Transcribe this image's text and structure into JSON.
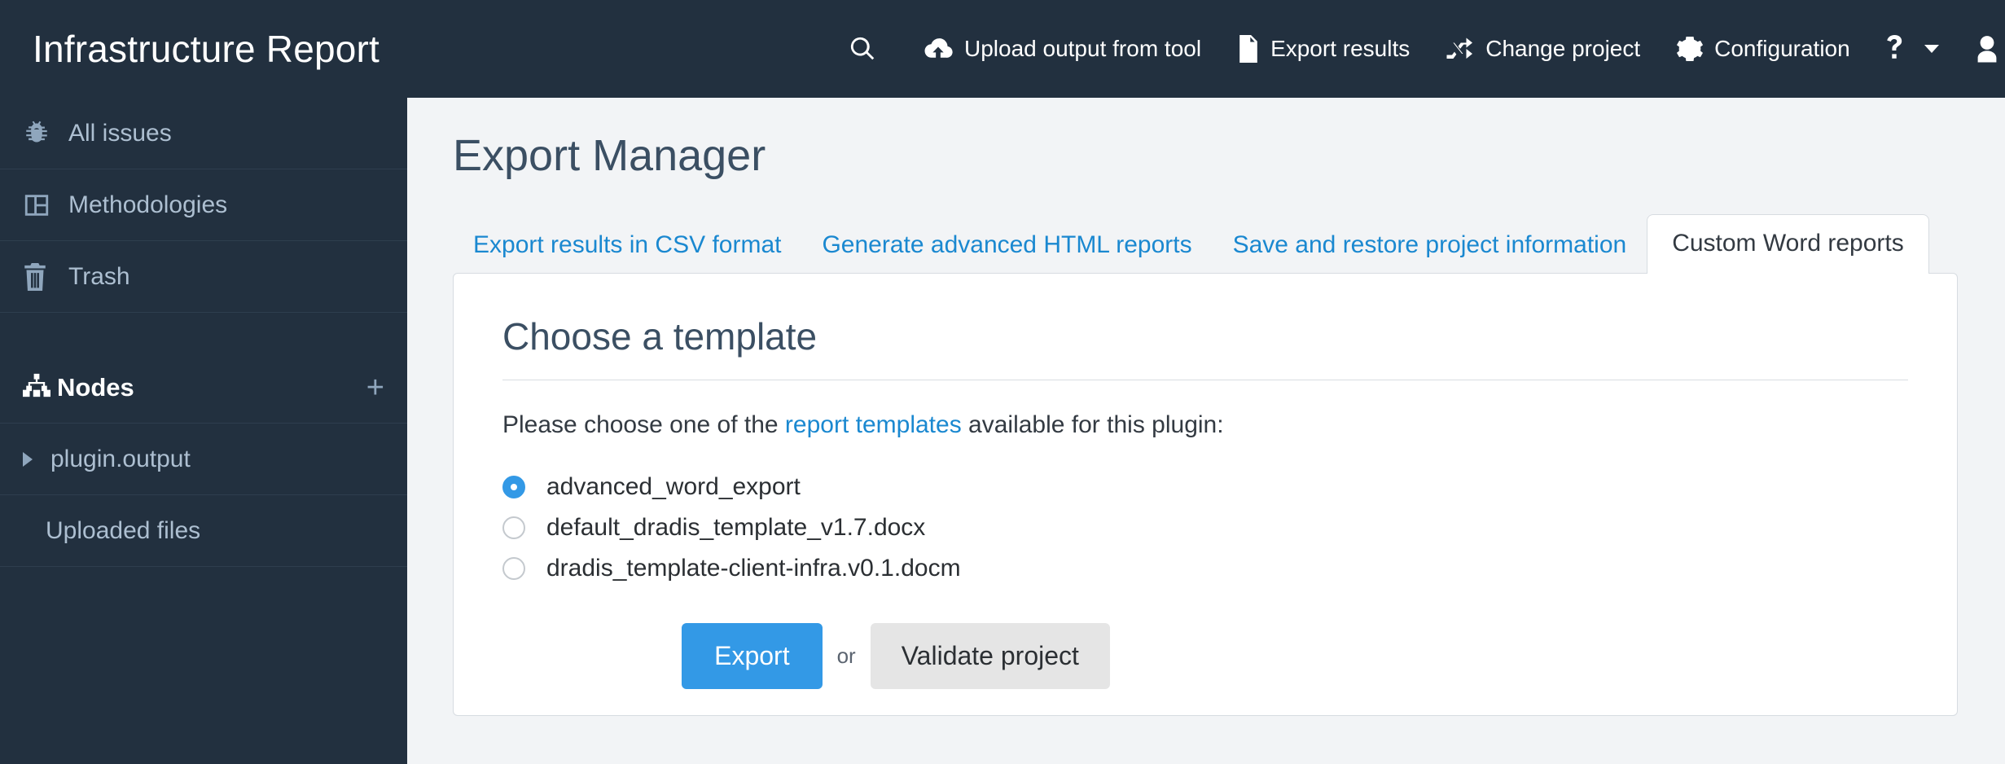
{
  "header": {
    "brand": "Infrastructure Report",
    "nav": [
      {
        "id": "search",
        "icon": "search-icon",
        "label": ""
      },
      {
        "id": "upload",
        "icon": "cloud-upload-icon",
        "label": "Upload output from tool"
      },
      {
        "id": "export",
        "icon": "document-icon",
        "label": "Export results"
      },
      {
        "id": "change-project",
        "icon": "shuffle-icon",
        "label": "Change project"
      },
      {
        "id": "configuration",
        "icon": "gear-icon",
        "label": "Configuration"
      },
      {
        "id": "help",
        "icon": "question-mark-icon",
        "label": ""
      },
      {
        "id": "user",
        "icon": "user-icon",
        "label": ""
      }
    ]
  },
  "sidebar": {
    "items": [
      {
        "icon": "bug-icon",
        "label": "All issues"
      },
      {
        "icon": "methodologies-icon",
        "label": "Methodologies"
      },
      {
        "icon": "trash-icon",
        "label": "Trash"
      }
    ],
    "nodes_header": {
      "icon": "sitemap-icon",
      "label": "Nodes",
      "add_label": "+"
    },
    "nodes": [
      {
        "label": "plugin.output",
        "expandable": true
      },
      {
        "label": "Uploaded files",
        "expandable": false
      }
    ]
  },
  "main": {
    "page_title": "Export Manager",
    "tabs": [
      {
        "label": "Export results in CSV format",
        "active": false
      },
      {
        "label": "Generate advanced HTML reports",
        "active": false
      },
      {
        "label": "Save and restore project information",
        "active": false
      },
      {
        "label": "Custom Word reports",
        "active": true
      }
    ],
    "card": {
      "title": "Choose a template",
      "lead_prefix": "Please choose one of the ",
      "lead_link": "report templates",
      "lead_suffix": " available for this plugin:",
      "options": [
        {
          "label": "advanced_word_export",
          "selected": true
        },
        {
          "label": "default_dradis_template_v1.7.docx",
          "selected": false
        },
        {
          "label": "dradis_template-client-infra.v0.1.docm",
          "selected": false
        }
      ],
      "export_label": "Export",
      "or_label": "or",
      "validate_label": "Validate project"
    }
  },
  "colors": {
    "topbar": "#22303f",
    "sidebar": "#22303f",
    "panel_bg": "#f2f4f6",
    "accent_link": "#1a88d0",
    "primary_button": "#3399e6",
    "default_button": "#e5e5e5",
    "heading": "#3b4f63",
    "sidebar_text": "#adbfd1"
  }
}
